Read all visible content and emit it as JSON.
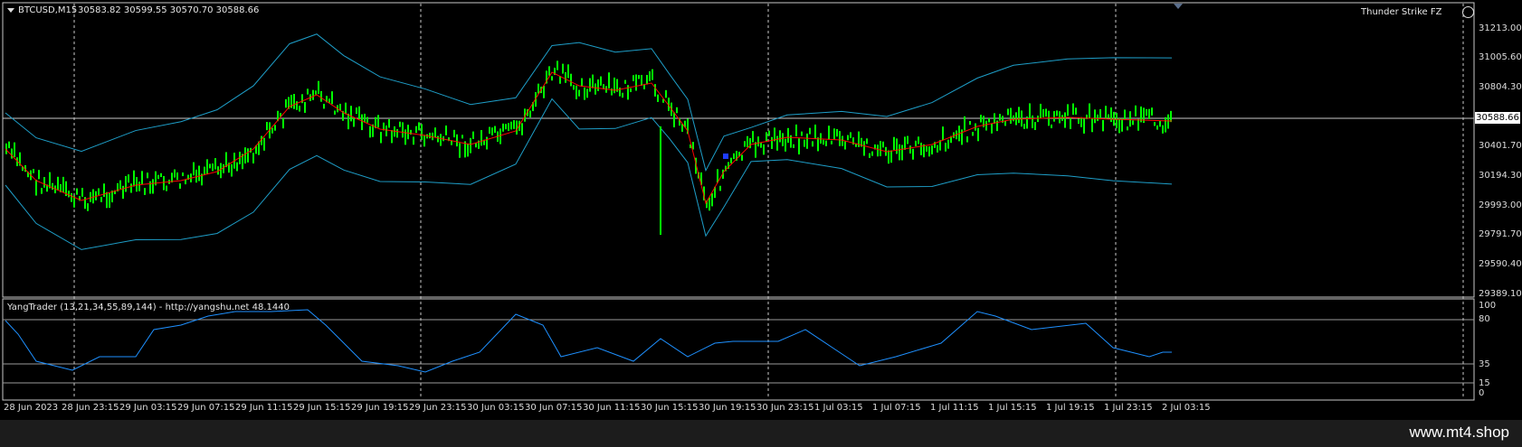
{
  "header": {
    "symbol": "BTCUSD,M15",
    "ohlc": "30583.82 30599.55 30570.70 30588.66",
    "expert_name": "Thunder Strike FZ"
  },
  "current_price": "30588.66",
  "price_axis": [
    "31213.00",
    "31005.60",
    "30804.30",
    "30401.70",
    "30194.30",
    "29993.00",
    "29791.70",
    "29590.40",
    "29389.10"
  ],
  "indicator": {
    "label": "YangTrader (13,21,34,55,89,144) - http://yangshu.net 48.1440",
    "levels": [
      "100",
      "80",
      "35",
      "15",
      "0"
    ]
  },
  "time_axis": [
    "28 Jun 2023",
    "28 Jun 23:15",
    "29 Jun 03:15",
    "29 Jun 07:15",
    "29 Jun 11:15",
    "29 Jun 15:15",
    "29 Jun 19:15",
    "29 Jun 23:15",
    "30 Jun 03:15",
    "30 Jun 07:15",
    "30 Jun 11:15",
    "30 Jun 15:15",
    "30 Jun 19:15",
    "30 Jun 23:15",
    "1 Jul 03:15",
    "1 Jul 07:15",
    "1 Jul 11:15",
    "1 Jul 15:15",
    "1 Jul 19:15",
    "1 Jul 23:15",
    "2 Jul 03:15"
  ],
  "watermark": "www.mt4.shop",
  "colors": {
    "candles": "#00ff00",
    "band": "#1e9ec8",
    "mid": "#ff0000",
    "indicator": "#1e90ff",
    "grid": "#c8c8c8"
  }
}
